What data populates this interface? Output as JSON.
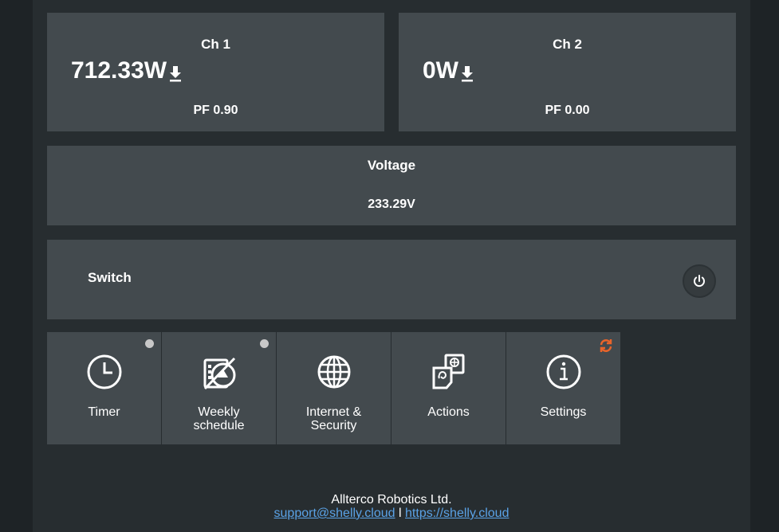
{
  "channels": [
    {
      "title": "Ch 1",
      "power": "712.33W",
      "pf": "PF 0.90"
    },
    {
      "title": "Ch 2",
      "power": "0W",
      "pf": "PF 0.00"
    }
  ],
  "voltage": {
    "title": "Voltage",
    "value": "233.29V"
  },
  "switch": {
    "label": "Switch"
  },
  "tiles": [
    {
      "label_line1": "Timer",
      "label_line2": "",
      "icon": "clock-icon",
      "indicator": "grey-dot"
    },
    {
      "label_line1": "Weekly",
      "label_line2": "schedule",
      "icon": "weekly-schedule-icon",
      "indicator": "grey-dot"
    },
    {
      "label_line1": "Internet &",
      "label_line2": "Security",
      "icon": "globe-icon",
      "indicator": ""
    },
    {
      "label_line1": "Actions",
      "label_line2": "",
      "icon": "actions-icon",
      "indicator": ""
    },
    {
      "label_line1": "Settings",
      "label_line2": "",
      "icon": "info-icon",
      "indicator": "update-sync-icon"
    }
  ],
  "footer": {
    "company": "Allterco Robotics Ltd.",
    "email": "support@shelly.cloud",
    "separator": "l",
    "website": "https://shelly.cloud"
  },
  "colors": {
    "page_bg": "#1e2326",
    "panel_bg": "#272d30",
    "card_bg": "#434a4e",
    "text": "#ffffff",
    "link": "#5aa2e6",
    "update_accent": "#e8642a",
    "indicator_dot": "#c8c8c8"
  }
}
